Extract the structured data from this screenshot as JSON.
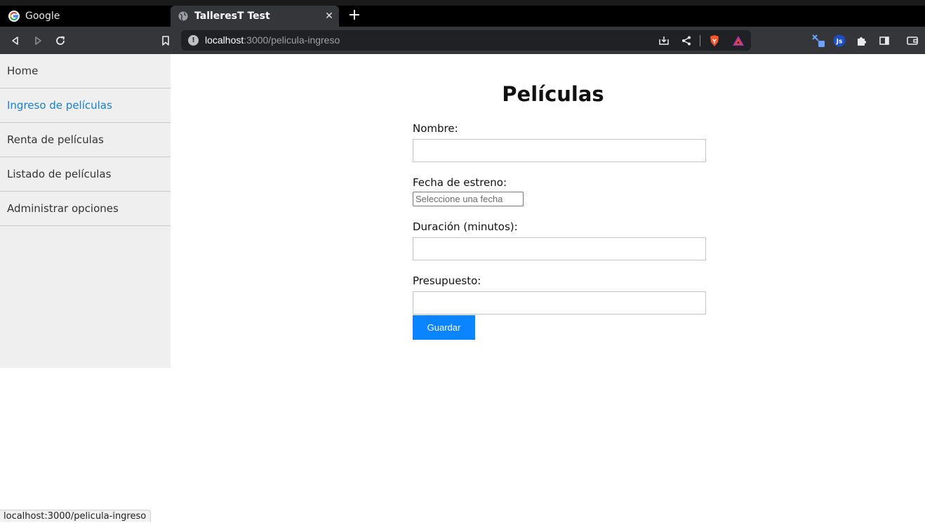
{
  "browser": {
    "tabs": [
      {
        "title": "Google",
        "favicon": "google-g-icon"
      },
      {
        "title": "TalleresT Test",
        "favicon": "globe-icon",
        "active": true
      }
    ],
    "url_host": "localhost",
    "url_path": ":3000/pelicula-ingreso"
  },
  "sidebar": {
    "items": [
      {
        "label": "Home"
      },
      {
        "label": "Ingreso de películas",
        "active": true
      },
      {
        "label": "Renta de películas"
      },
      {
        "label": "Listado de películas"
      },
      {
        "label": "Administrar opciones"
      }
    ]
  },
  "main": {
    "title": "Películas",
    "fields": {
      "nombre_label": "Nombre:",
      "nombre_value": "",
      "fecha_label": "Fecha de estreno:",
      "fecha_placeholder": "Seleccione una fecha",
      "duracion_label": "Duración (minutos):",
      "duracion_value": "",
      "presupuesto_label": "Presupuesto:",
      "presupuesto_value": ""
    },
    "save_label": "Guardar"
  },
  "status_bar": "localhost:3000/pelicula-ingreso",
  "colors": {
    "accent": "#0a84ff",
    "active_link": "#1380d8",
    "sidebar_bg": "#efefef"
  }
}
